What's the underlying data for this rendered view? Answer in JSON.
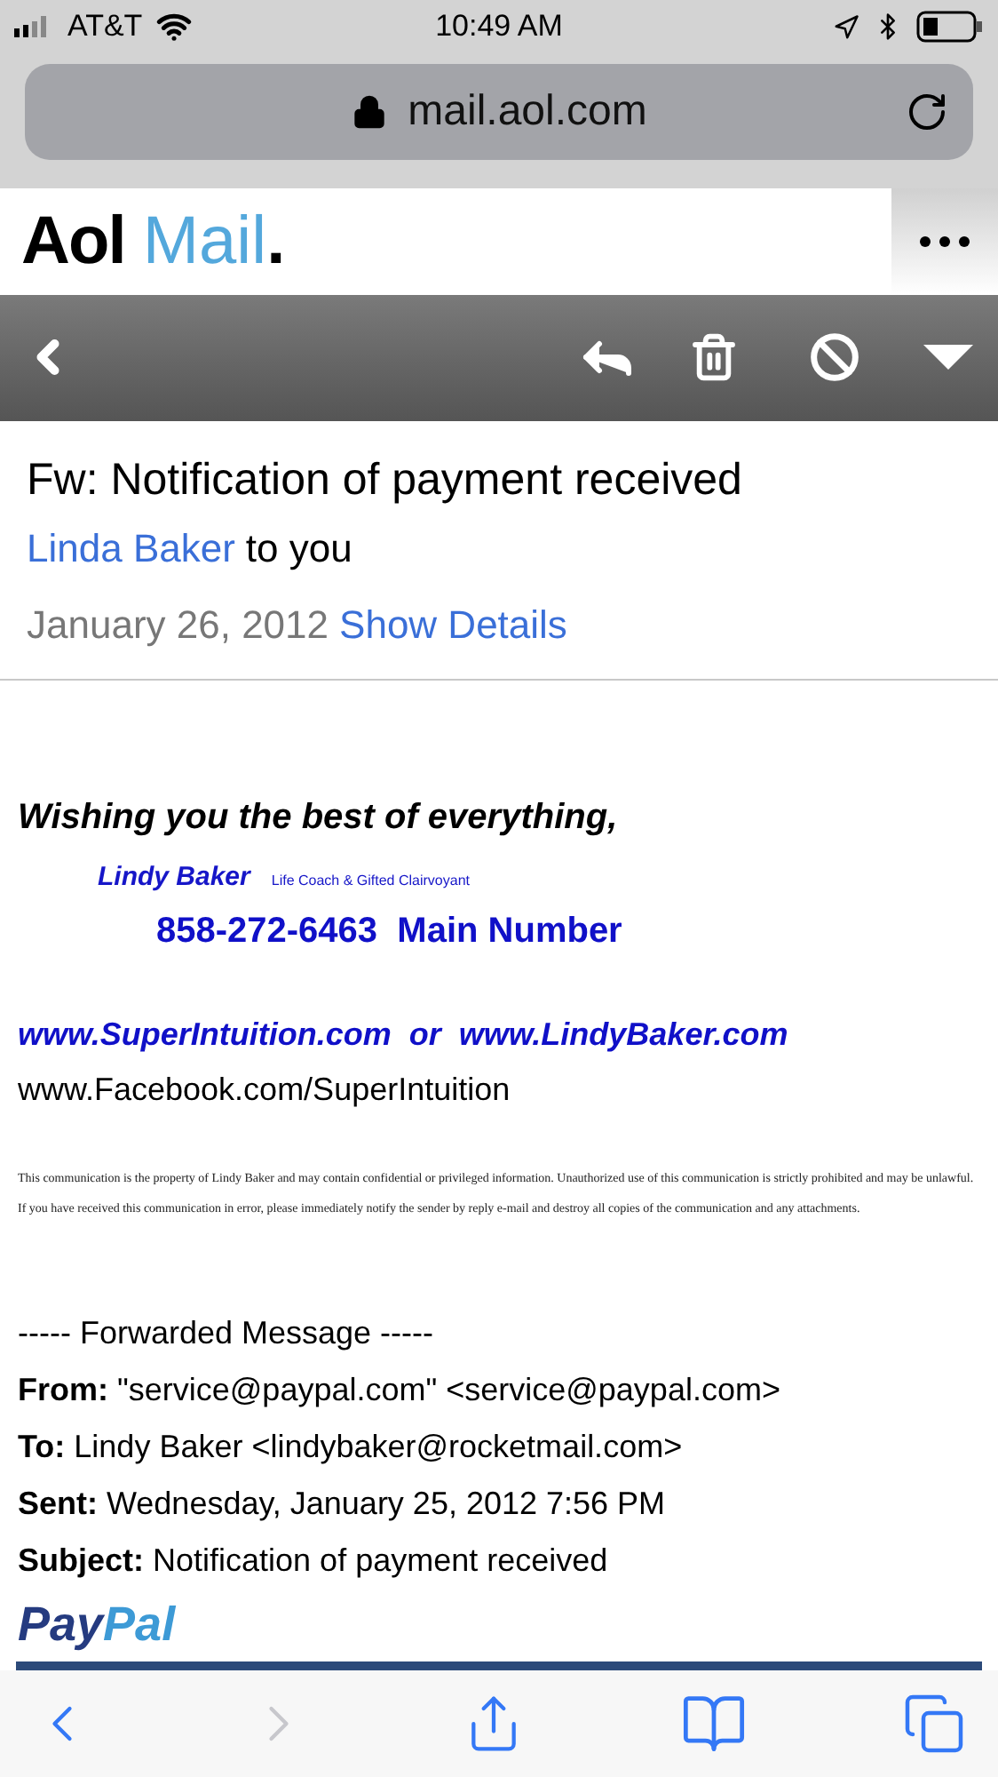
{
  "status_bar": {
    "carrier": "AT&T",
    "time": "10:49 AM"
  },
  "address_bar": {
    "url": "mail.aol.com"
  },
  "app_header": {
    "logo_brand": "Aol",
    "logo_product": "Mail",
    "logo_dot": "."
  },
  "email": {
    "subject": "Fw: Notification of payment received",
    "sender": "Linda Baker",
    "recipient_text": "to you",
    "date": "January 26, 2012",
    "details_link": "Show Details"
  },
  "signature": {
    "greeting": "Wishing you the best of everything,",
    "name": "Lindy Baker",
    "title": "Life Coach & Gifted Clairvoyant",
    "phone": "858-272-6463  Main Number",
    "websites": "www.SuperIntuition.com  or  www.LindyBaker.com",
    "facebook": "www.Facebook.com/SuperIntuition",
    "disclaimer": "This communication is the property of Lindy Baker and may contain confidential or privileged information. Unauthorized use of this communication is strictly prohibited and may be unlawful.  If you have received this communication in error, please immediately notify the sender by reply e-mail and destroy all copies of the communication and any attachments."
  },
  "forwarded": {
    "divider": "----- Forwarded Message -----",
    "fields": [
      {
        "text": "**From:** \"service@paypal.com\" <service@paypal.com>"
      },
      {
        "text": "**To:** Lindy Baker <lindybaker@rocketmail.com>"
      },
      {
        "text": "**Sent:** Wednesday, January 25, 2012 7:56 PM"
      },
      {
        "text": "**Subject:** Notification of payment received"
      }
    ],
    "logo_part1": "Pay",
    "logo_part2": "Pal"
  },
  "browser_toolbar": {
    "back_disabled": false,
    "forward_disabled": true
  }
}
